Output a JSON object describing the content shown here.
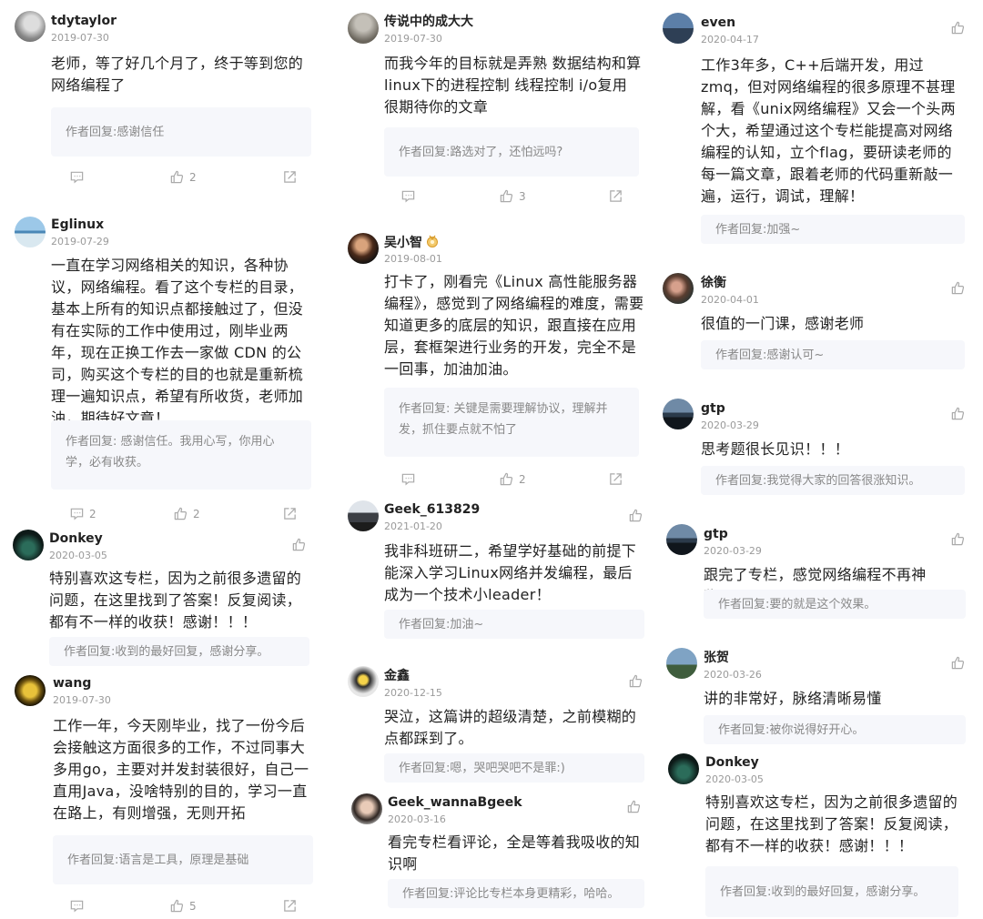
{
  "reply_prefix": "作者回复: ",
  "columns": [
    {
      "comments": [
        {
          "user": "tdytaylor",
          "date": "2019-07-30",
          "text": "老师，等了好几个月了，终于等到您的网络编程了",
          "reply": "感谢信任",
          "comments_count": "",
          "likes": "2"
        },
        {
          "user": "Eglinux",
          "date": "2019-07-29",
          "text": "一直在学习网络相关的知识，各种协议，网络编程。看了这个专栏的目录，基本上所有的知识点都接触过了，但没有在实际的工作中使用过，刚毕业两年，现在正换工作去一家做 CDN 的公司，购买这个专栏的目的也就是重新梳理一遍知识点，希望有所收货，老师加油，期待好文章！",
          "reply": "感谢信任。我用心写，你用心学，必有收获。",
          "comments_count": "2",
          "likes": "2"
        },
        {
          "user": "Donkey",
          "date": "2020-03-05",
          "text": "特别喜欢这专栏，因为之前很多遗留的问题，在这里找到了答案！反复阅读，都有不一样的收获！感谢！！！",
          "reply": "收到的最好回复，感谢分享。"
        },
        {
          "user": "wang",
          "date": "2019-07-30",
          "text": "工作一年，今天刚毕业，找了一份今后会接触这方面很多的工作，不过同事大多用go，主要对并发封装很好，自己一直用Java，没啥特别的目的，学习一直在路上，有则增强，无则开拓",
          "reply": "语言是工具，原理是基础",
          "comments_count": "",
          "likes": "5"
        }
      ]
    },
    {
      "comments": [
        {
          "user": "传说中的成大大",
          "date": "2019-07-30",
          "text": "而我今年的目标就是弄熟 数据结构和算 linux下的进程控制 线程控制 i/o复用 很期待你的文章",
          "reply": "路选对了，还怕远吗?",
          "comments_count": "",
          "likes": "3"
        },
        {
          "user": "吴小智",
          "date": "2019-08-01",
          "text": "打卡了，刚看完《Linux 高性能服务器编程》，感觉到了网络编程的难度，需要知道更多的底层的知识，跟直接在应用层，套框架进行业务的开发，完全不是一回事，加油加油。",
          "reply": "关键是需要理解协议，理解并发，抓住要点就不怕了",
          "comments_count": "",
          "likes": "2"
        },
        {
          "user": "Geek_613829",
          "date": "2021-01-20",
          "text": "我非科班研二，希望学好基础的前提下能深入学习Linux网络并发编程，最后成为一个技术小leader！",
          "reply": "加油~"
        },
        {
          "user": "金鑫",
          "date": "2020-12-15",
          "text": "哭泣，这篇讲的超级清楚，之前模糊的点都踩到了。",
          "reply": "嗯，哭吧哭吧不是罪:)"
        },
        {
          "user": "Geek_wannaBgeek",
          "date": "2020-03-16",
          "text": "看完专栏看评论，全是等着我吸收的知识啊",
          "reply": "评论比专栏本身更精彩，哈哈。"
        }
      ]
    },
    {
      "comments": [
        {
          "user": "even",
          "date": "2020-04-17",
          "text": "工作3年多，C++后端开发，用过zmq，但对网络编程的很多原理不甚理解，看《unix网络编程》又会一个头两个大，希望通过这个专栏能提高对网络编程的认知，立个flag，要研读老师的每一篇文章，跟着老师的代码重新敲一遍，运行，调试，理解！",
          "reply": "加强~"
        },
        {
          "user": "徐衡",
          "date": "2020-04-01",
          "text": "很值的一门课，感谢老师",
          "reply": "感谢认可~"
        },
        {
          "user": "gtp",
          "date": "2020-03-29",
          "text": "思考题很长见识！！！",
          "reply": "我觉得大家的回答很涨知识。"
        },
        {
          "user": "gtp",
          "date": "2020-03-29",
          "text": "跟完了专栏，感觉网络编程不再神秘！！",
          "reply": "要的就是这个效果。"
        },
        {
          "user": "张贺",
          "date": "2020-03-26",
          "text": "讲的非常好，脉络清晰易懂",
          "reply": "被你说得好开心。"
        },
        {
          "user": "Donkey",
          "date": "2020-03-05",
          "text": "特别喜欢这专栏，因为之前很多遗留的问题，在这里找到了答案！反复阅读，都有不一样的收获！感谢！！！",
          "reply": "收到的最好回复，感谢分享。"
        }
      ]
    }
  ]
}
